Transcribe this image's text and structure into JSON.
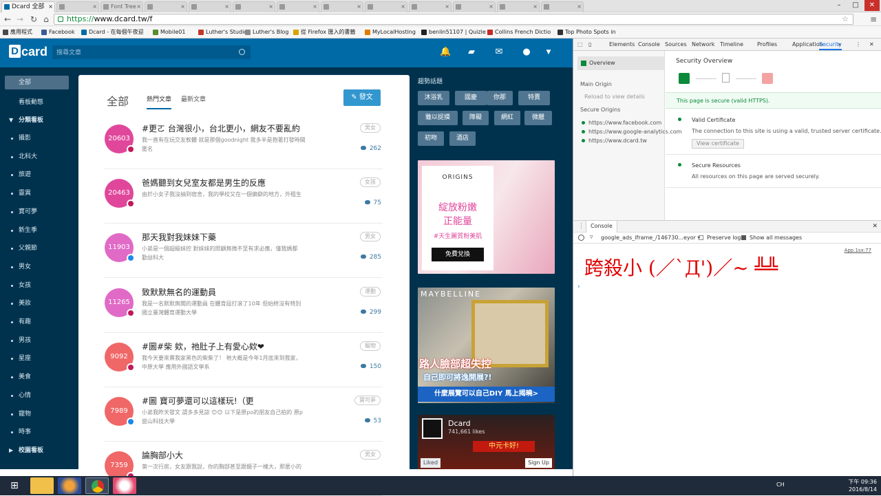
{
  "browser": {
    "tabs": [
      {
        "title": "Dcard 全部",
        "active": true
      },
      {
        "title": "",
        "active": false
      },
      {
        "title": "Font Tree",
        "active": false
      },
      {
        "title": "",
        "active": false
      },
      {
        "title": "",
        "active": false
      },
      {
        "title": "",
        "active": false
      },
      {
        "title": "",
        "active": false
      },
      {
        "title": "",
        "active": false
      },
      {
        "title": "",
        "active": false
      },
      {
        "title": "",
        "active": false
      },
      {
        "title": "",
        "active": false
      },
      {
        "title": "",
        "active": false
      },
      {
        "title": "",
        "active": false
      }
    ],
    "url_scheme": "https://",
    "url_host": "www.dcard.tw",
    "url_path": "/f",
    "bookmarks": [
      {
        "label": "應用程式",
        "color": "#4a4a4a"
      },
      {
        "label": "Facebook",
        "color": "#3b5998"
      },
      {
        "label": "Dcard - 在每個午夜迎",
        "color": "#006aa6"
      },
      {
        "label": "Mobile01",
        "color": "#5a8c2c"
      },
      {
        "label": "Luther's Studio",
        "color": "#c0392b"
      },
      {
        "label": "Luther's Blog",
        "color": "#8a8a8a"
      },
      {
        "label": "從 Firefox 匯入的書籤",
        "color": "#d9a400"
      },
      {
        "label": "MyLocalHosting",
        "color": "#e07b00"
      },
      {
        "label": "benlin51107 | Quizle",
        "color": "#222222"
      },
      {
        "label": "Collins French Dictio",
        "color": "#c62828"
      },
      {
        "label": "Top Photo Spots in",
        "color": "#333333"
      }
    ]
  },
  "dcard": {
    "logo": "card",
    "logo_d": "D",
    "search_placeholder": "搜尋文章",
    "sidebar": [
      {
        "label": "全部",
        "type": "active"
      },
      {
        "label": "看板動態",
        "type": "plain"
      },
      {
        "label": "分類看板",
        "type": "group"
      },
      {
        "label": "攝影",
        "type": "item"
      },
      {
        "label": "北科大",
        "type": "item"
      },
      {
        "label": "旅遊",
        "type": "item"
      },
      {
        "label": "靈異",
        "type": "item"
      },
      {
        "label": "寶可夢",
        "type": "item"
      },
      {
        "label": "新生季",
        "type": "item"
      },
      {
        "label": "父親節",
        "type": "item"
      },
      {
        "label": "男女",
        "type": "item"
      },
      {
        "label": "女孩",
        "type": "item"
      },
      {
        "label": "美妝",
        "type": "item"
      },
      {
        "label": "有趣",
        "type": "item"
      },
      {
        "label": "男孩",
        "type": "item"
      },
      {
        "label": "星座",
        "type": "item"
      },
      {
        "label": "美食",
        "type": "item"
      },
      {
        "label": "心情",
        "type": "item"
      },
      {
        "label": "寵物",
        "type": "item"
      },
      {
        "label": "時事",
        "type": "item"
      },
      {
        "label": "校園看板",
        "type": "group-collapsed"
      }
    ],
    "main_title": "全部",
    "tab_hot": "熱門文章",
    "tab_new": "最新文章",
    "post_button": "發文",
    "posts": [
      {
        "likes": "20603",
        "color": "#e0479b",
        "gender": "#c2185b",
        "title": "#更ㄛ 台灣很小，台北更小，網友不要亂約",
        "excerpt": "我一直有在玩交友軟體 就是那個goodnight 我多半是抱著打發時間",
        "school": "匿名",
        "tag": "男女",
        "comments": "262"
      },
      {
        "likes": "20463",
        "color": "#e0479b",
        "gender": "#c2185b",
        "title": "爸媽聽到女兒室友都是男生的反應",
        "excerpt": "由於小女子我沒抽到宿舍，我的學校又在一個偏僻的地方，外租生",
        "school": "",
        "tag": "女孩",
        "comments": "75"
      },
      {
        "likes": "11903",
        "color": "#e06ac6",
        "gender": "#1e88e5",
        "title": "那天我對我妹妹下藥",
        "excerpt": "小弟是一個超級妹控 對妹妹的照顧無微不至有求必應，僅我媽都",
        "school": "勤益科大",
        "tag": "男女",
        "comments": "285"
      },
      {
        "likes": "11265",
        "color": "#e06ac6",
        "gender": "#c2185b",
        "title": "致默默無名的運動員",
        "excerpt": "我是一名默默無聞的運動員 在體育屆打滾了10年 但始終沒有特別",
        "school": "國立臺灣體育運動大學",
        "tag": "運動",
        "comments": "299"
      },
      {
        "likes": "9092",
        "color": "#f06767",
        "gender": "#c2185b",
        "title": "#圖#柴 欸，祂肚子上有愛心欸❤",
        "excerpt": "我今天要來賣我家黑色的柴柴了！ 祂大概是今年1月底來到我家，",
        "school": "中原大學 應用外國語文學系",
        "tag": "寵物",
        "comments": "150"
      },
      {
        "likes": "7989",
        "color": "#f06767",
        "gender": "#1e88e5",
        "title": "#圖 寶可夢還可以這樣玩!（更",
        "excerpt": "小弟我昨天發文 請多多見諒 😊😊 以下是原po的朋友自己拍的 原p",
        "school": "崑山科技大學",
        "tag": "寶可夢",
        "comments": "53"
      },
      {
        "likes": "7359",
        "color": "#f06767",
        "gender": "#c2185b",
        "title": "論胸部小大",
        "excerpt": "第一次行房，女友跟我說，你的胸部甚至跟鏡子一樣大，那麼小的",
        "school": "",
        "tag": "男女",
        "comments": ""
      }
    ],
    "trending_title": "趨勢話題",
    "trending": [
      "沐浴乳",
      "國慶",
      "你那",
      "特賣",
      "雖以捉摸",
      "障礙",
      "網紅",
      "微臘",
      "初吻",
      "酒店"
    ],
    "ad1": {
      "brand": "ORIGINS",
      "line1": "綻放粉嫩",
      "line2": "正能量",
      "sub": "#天生麗質粉美肌",
      "cta": "免費兌換"
    },
    "ad2": {
      "brand": "MAYBELLINE",
      "line1": "路人臉部超失控",
      "line2": "自己即可將逸開展?!",
      "line3": "什麼展覽可以自己DIY 馬上揭曉>"
    },
    "fb": {
      "name": "Dcard",
      "likes": "741,661 likes",
      "liked": "Liked",
      "signup": "Sign Up",
      "banner": "中元卡好!"
    }
  },
  "devtools": {
    "tabs": [
      "Elements",
      "Console",
      "Sources",
      "Network",
      "Timeline",
      "Profiles",
      "Application",
      "Security"
    ],
    "overview": "Overview",
    "main_origin": "Main Origin",
    "reload_note": "Reload to view details",
    "secure_origins": "Secure Origins",
    "origins": [
      "https://www.facebook.com",
      "https://www.google-analytics.com",
      "https://www.dcard.tw"
    ],
    "sec_title": "Security Overview",
    "secure_msg": "This page is secure (valid HTTPS).",
    "valid_cert": "Valid Certificate",
    "valid_cert_desc": "The connection to this site is using a valid, trusted server certificate.",
    "view_cert": "View certificate",
    "secure_res": "Secure Resources",
    "secure_res_desc": "All resources on this page are served securely.",
    "console_tab": "Console",
    "frame_select": "google_ads_iframe_/146730...eyor",
    "preserve_log": "Preserve log",
    "show_all": "Show all messages",
    "source_link": "App.1sx:77",
    "log_text": "跨殺小 (／`Д')／~ ╩╩"
  },
  "taskbar": {
    "lang": "CH",
    "time": "下午 09:36",
    "date": "2016/8/14"
  }
}
